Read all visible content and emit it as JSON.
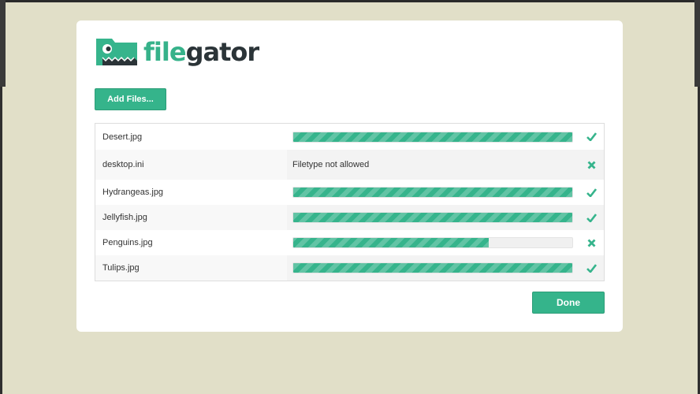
{
  "app": {
    "logo_part1": "file",
    "logo_part2": "gator"
  },
  "toolbar": {
    "add_files_label": "Add Files..."
  },
  "footer": {
    "done_label": "Done"
  },
  "colors": {
    "accent": "#36b48c",
    "background": "#e1dfc8",
    "text_dark": "#2b3438"
  },
  "uploads": [
    {
      "name": "Desert.jpg",
      "progress": 1.0,
      "status_icon": "check-icon",
      "message": ""
    },
    {
      "name": "desktop.ini",
      "progress": null,
      "status_icon": "cross-icon",
      "message": "Filetype not allowed"
    },
    {
      "name": "Hydrangeas.jpg",
      "progress": 1.0,
      "status_icon": "check-icon",
      "message": ""
    },
    {
      "name": "Jellyfish.jpg",
      "progress": 1.0,
      "status_icon": "check-icon",
      "message": ""
    },
    {
      "name": "Penguins.jpg",
      "progress": 0.7,
      "status_icon": "cross-icon",
      "message": ""
    },
    {
      "name": "Tulips.jpg",
      "progress": 1.0,
      "status_icon": "check-icon",
      "message": ""
    }
  ]
}
